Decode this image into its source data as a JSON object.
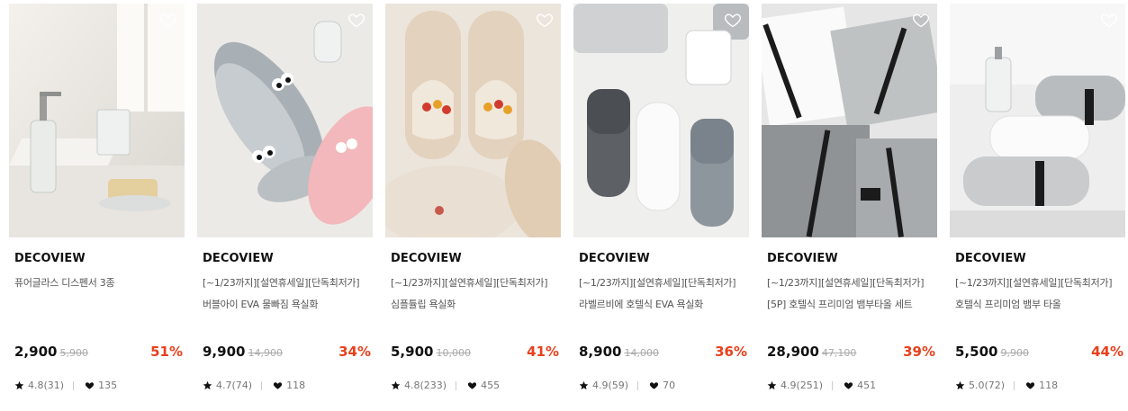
{
  "products": [
    {
      "brand": "DECOVIEW",
      "name_line1": "퓨어글라스 디스펜서 3종",
      "name_line2": "",
      "price": "2,900",
      "original_price": "5,900",
      "discount": "51%",
      "rating": "4.8(31)",
      "likes": "135",
      "image_icon": "glass-dispenser-photo"
    },
    {
      "brand": "DECOVIEW",
      "name_line1": "[~1/23까지][설연휴세일][단독최저가]",
      "name_line2": "버블아이 EVA 물빠짐 욕실화",
      "price": "9,900",
      "original_price": "14,900",
      "discount": "34%",
      "rating": "4.7(74)",
      "likes": "118",
      "image_icon": "bubble-eye-slippers-photo"
    },
    {
      "brand": "DECOVIEW",
      "name_line1": "[~1/23까지][설연휴세일][단독최저가]",
      "name_line2": "심플튤립 욕실화",
      "price": "5,900",
      "original_price": "10,000",
      "discount": "41%",
      "rating": "4.8(233)",
      "likes": "455",
      "image_icon": "tulip-slippers-photo"
    },
    {
      "brand": "DECOVIEW",
      "name_line1": "[~1/23까지][설연휴세일][단독최저가]",
      "name_line2": "라벨르비에 호텔식 EVA 욕실화",
      "price": "8,900",
      "original_price": "14,000",
      "discount": "36%",
      "rating": "4.9(59)",
      "likes": "70",
      "image_icon": "eva-slippers-photo"
    },
    {
      "brand": "DECOVIEW",
      "name_line1": "[~1/23까지][설연휴세일][단독최저가]",
      "name_line2": "[5P] 호텔식 프리미엄 뱀부타올 세트",
      "price": "28,900",
      "original_price": "47,100",
      "discount": "39%",
      "rating": "4.9(251)",
      "likes": "451",
      "image_icon": "bamboo-towel-set-photo"
    },
    {
      "brand": "DECOVIEW",
      "name_line1": "[~1/23까지][설연휴세일][단독최저가]",
      "name_line2": "호텔식 프리미엄 뱀부 타올",
      "price": "5,500",
      "original_price": "9,900",
      "discount": "44%",
      "rating": "5.0(72)",
      "likes": "118",
      "image_icon": "bamboo-towel-photo"
    }
  ],
  "colors": {
    "discount": "#e8401c",
    "original_price": "#aaaaaa",
    "text_primary": "#111111",
    "text_secondary": "#555555"
  },
  "icons": {
    "wishlist": "heart-outline-icon",
    "rating": "star-icon",
    "likes": "heart-filled-icon"
  }
}
